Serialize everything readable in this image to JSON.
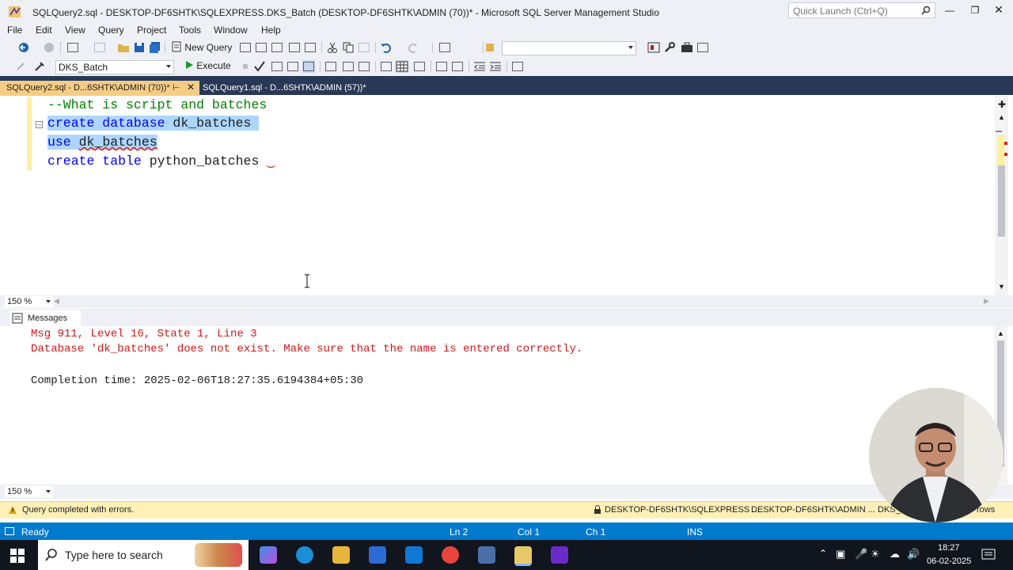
{
  "window": {
    "title": "SQLQuery2.sql - DESKTOP-DF6SHTK\\SQLEXPRESS.DKS_Batch (DESKTOP-DF6SHTK\\ADMIN (70))* - Microsoft SQL Server Management Studio",
    "quick_launch_placeholder": "Quick Launch (Ctrl+Q)"
  },
  "menu": [
    "File",
    "Edit",
    "View",
    "Query",
    "Project",
    "Tools",
    "Window",
    "Help"
  ],
  "toolbar": {
    "new_query_label": "New Query",
    "database": "DKS_Batch",
    "execute_label": "Execute"
  },
  "tabs": [
    {
      "label": "SQLQuery2.sql - D...6SHTK\\ADMIN (70))*",
      "active": true
    },
    {
      "label": "SQLQuery1.sql - D...6SHTK\\ADMIN (57))*",
      "active": false
    }
  ],
  "editor": {
    "lines": [
      "--What is script and batches",
      "create database dk_batches",
      "use dk_batches",
      "create table python_batches"
    ],
    "zoom": "150 %"
  },
  "messages": {
    "tab_label": "Messages",
    "line1": "Msg 911, Level 16, State 1, Line 3",
    "line2": "Database 'dk_batches' does not exist. Make sure that the name is entered correctly.",
    "line3": "Completion time: 2025-02-06T18:27:35.6194384+05:30",
    "zoom": "150 %"
  },
  "query_status": {
    "text": "Query completed with errors.",
    "server": "DESKTOP-DF6SHTK\\SQLEXPRESS ...",
    "user": "DESKTOP-DF6SHTK\\ADMIN ...",
    "db": "DKS_",
    "rows": "rows"
  },
  "statusbar": {
    "ready": "Ready",
    "ln": "Ln 2",
    "col": "Col 1",
    "ch": "Ch 1",
    "mode": "INS"
  },
  "taskbar": {
    "search_placeholder": "Type here to search",
    "time": "18:27",
    "date": "06-02-2025"
  },
  "colors": {
    "keyword": "#0000ff",
    "comment": "#008000",
    "error": "#d01818",
    "statusbar": "#007acc",
    "active_tab": "#f5cc84"
  }
}
